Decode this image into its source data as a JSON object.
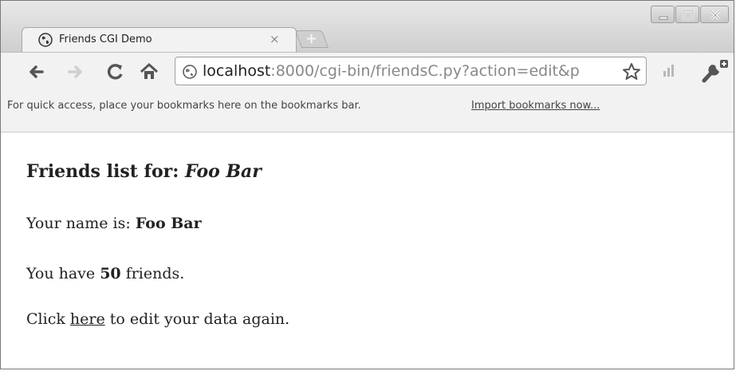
{
  "browser": {
    "tab_title": "Friends CGI Demo",
    "tab_close": "×",
    "new_tab": "+",
    "url_host": "localhost",
    "url_rest": ":8000/cgi-bin/friendsC.py?action=edit&p",
    "bookmarks_hint": "For quick access, place your bookmarks here on the bookmarks bar.",
    "bookmarks_import": "Import bookmarks now..."
  },
  "page": {
    "heading_prefix": "Friends list for: ",
    "heading_name": "Foo Bar",
    "name_prefix": "Your name is: ",
    "name_value": "Foo Bar",
    "friends_prefix": "You have ",
    "friends_count": "50",
    "friends_suffix": " friends.",
    "edit_prefix": "Click ",
    "edit_link": "here",
    "edit_suffix": " to edit your data again."
  }
}
